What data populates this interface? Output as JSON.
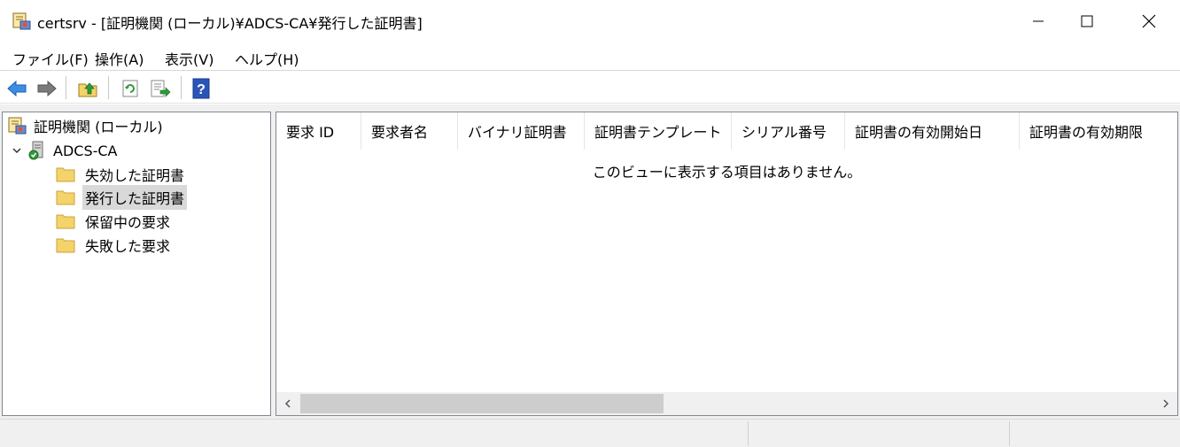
{
  "window": {
    "title": "certsrv - [証明機関 (ローカル)¥ADCS-CA¥発行した証明書]",
    "app_icon": "certsrv-icon",
    "controls": [
      "minimize-icon",
      "maximize-icon",
      "close-icon"
    ]
  },
  "menu": {
    "file": "ファイル(F)",
    "action": "操作(A)",
    "view": "表示(V)",
    "help": "ヘルプ(H)"
  },
  "toolbar": {
    "buttons": [
      "back-arrow-icon",
      "forward-arrow-icon",
      "up-folder-icon",
      "refresh-icon",
      "export-list-icon",
      "help-icon"
    ]
  },
  "tree": {
    "root": "証明機関 (ローカル)",
    "ca": "ADCS-CA",
    "folders": [
      "失効した証明書",
      "発行した証明書",
      "保留中の要求",
      "失敗した要求"
    ],
    "selected": "発行した証明書"
  },
  "list": {
    "columns": [
      "要求 ID",
      "要求者名",
      "バイナリ証明書",
      "証明書テンプレート",
      "シリアル番号",
      "証明書の有効開始日",
      "証明書の有効期限"
    ],
    "empty_message": "このビューに表示する項目はありません。"
  },
  "colors": {
    "accent_blue": "#1e6fd0",
    "folder_yellow": "#f5d36b",
    "selection_gray": "#d9d9d9"
  }
}
